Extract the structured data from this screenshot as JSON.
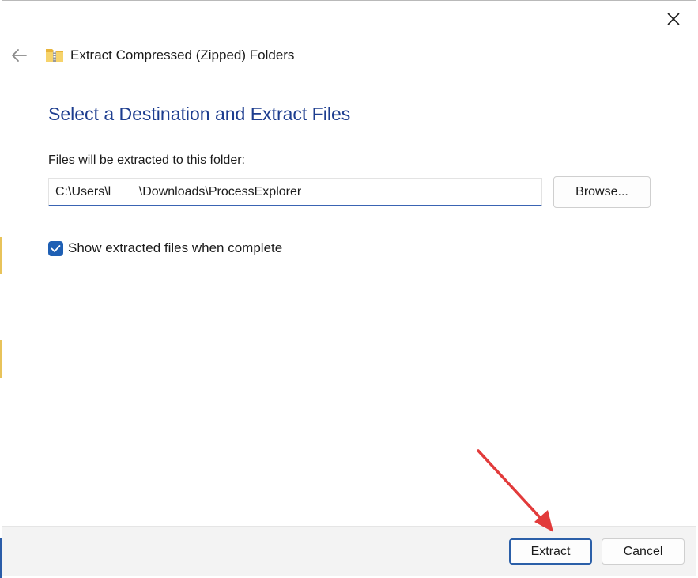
{
  "window": {
    "title": "Extract Compressed (Zipped) Folders",
    "title_icon": "zip-folder-icon",
    "close_icon": "close-icon",
    "back_icon": "back-arrow-icon"
  },
  "main": {
    "heading": "Select a Destination and Extract Files",
    "destination_label": "Files will be extracted to this folder:",
    "destination_path": "C:\\Users\\l        \\Downloads\\ProcessExplorer",
    "browse_label": "Browse...",
    "show_files_checked": true,
    "show_files_label": "Show extracted files when complete"
  },
  "footer": {
    "extract_label": "Extract",
    "cancel_label": "Cancel"
  },
  "colors": {
    "heading": "#1d3d8f",
    "accent": "#1e5fb4",
    "annotation_arrow": "#e23b3b"
  }
}
